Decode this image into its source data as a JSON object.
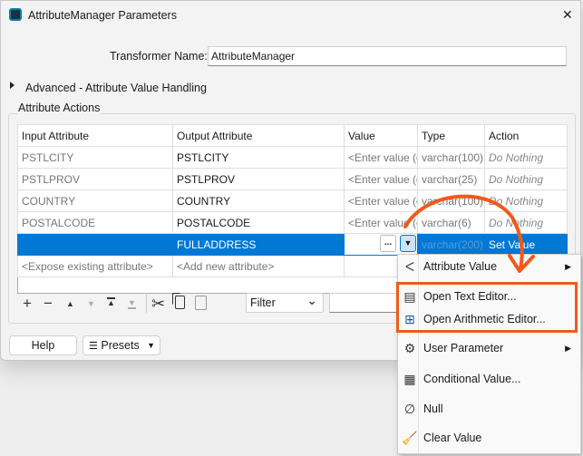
{
  "window": {
    "title": "AttributeManager Parameters",
    "close": "✕"
  },
  "transformer": {
    "label": "Transformer Name:",
    "value": "AttributeManager"
  },
  "advanced": {
    "label": "Advanced - Attribute Value Handling"
  },
  "group": {
    "label": "Attribute Actions"
  },
  "table": {
    "headers": [
      "Input Attribute",
      "Output Attribute",
      "Value",
      "Type",
      "Action"
    ],
    "rows": [
      [
        "PSTLCITY",
        "PSTLCITY",
        "<Enter value (o",
        "varchar(100)",
        "Do Nothing"
      ],
      [
        "PSTLPROV",
        "PSTLPROV",
        "<Enter value (o",
        "varchar(25)",
        "Do Nothing"
      ],
      [
        "COUNTRY",
        "COUNTRY",
        "<Enter value (o",
        "varchar(100)",
        "Do Nothing"
      ],
      [
        "POSTALCODE",
        "POSTALCODE",
        "<Enter value (o",
        "varchar(6)",
        "Do Nothing"
      ],
      [
        "",
        "FULLADDRESS",
        "",
        "varchar(200)",
        "Set Value"
      ]
    ],
    "new_row": [
      "<Expose existing attribute>",
      "<Add new attribute>"
    ],
    "ellipsis": "...",
    "dropdown": "▼"
  },
  "toolbar": {
    "filter": "Filter"
  },
  "buttons": {
    "help": "Help",
    "presets": "Presets"
  },
  "menu": {
    "items": [
      {
        "label": "Attribute Value",
        "icon": "attribute-value-icon",
        "submenu": true
      },
      {
        "label": "Open Text Editor...",
        "icon": "text-editor-icon"
      },
      {
        "label": "Open Arithmetic Editor...",
        "icon": "arithmetic-editor-icon"
      },
      {
        "label": "User Parameter",
        "icon": "user-parameter-icon",
        "submenu": true
      },
      {
        "label": "Conditional Value...",
        "icon": "conditional-value-icon"
      },
      {
        "label": "Null",
        "icon": "null-icon"
      },
      {
        "label": "Clear Value",
        "icon": "clear-value-icon"
      }
    ]
  },
  "colors": {
    "accent": "#0078d4",
    "annotation": "#f05a1a"
  }
}
